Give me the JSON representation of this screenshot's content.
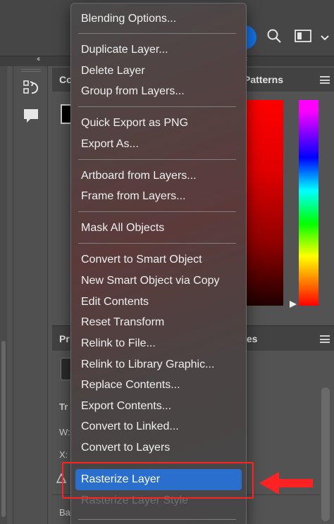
{
  "background": {
    "color_panel_tab_fragment": "Co",
    "patterns_tab_label": "Patterns",
    "properties_tab_fragment": "Pr",
    "libraries_tab_fragment": "ies",
    "transform_label_fragment": "Tr",
    "width_label": "W:",
    "x_label": "X:",
    "background_label_fragment": "Ba"
  },
  "context_menu": {
    "items": [
      {
        "label": "Blending Options..."
      },
      {
        "label": "Duplicate Layer..."
      },
      {
        "label": "Delete Layer"
      },
      {
        "label": "Group from Layers..."
      },
      {
        "label": "Quick Export as PNG"
      },
      {
        "label": "Export As..."
      },
      {
        "label": "Artboard from Layers..."
      },
      {
        "label": "Frame from Layers..."
      },
      {
        "label": "Mask All Objects"
      },
      {
        "label": "Convert to Smart Object"
      },
      {
        "label": "New Smart Object via Copy"
      },
      {
        "label": "Edit Contents"
      },
      {
        "label": "Reset Transform"
      },
      {
        "label": "Relink to File..."
      },
      {
        "label": "Relink to Library Graphic..."
      },
      {
        "label": "Replace Contents..."
      },
      {
        "label": "Export Contents..."
      },
      {
        "label": "Convert to Linked..."
      },
      {
        "label": "Convert to Layers"
      },
      {
        "label": "Rasterize Layer",
        "state": "highlighted"
      },
      {
        "label": "Rasterize Layer Style",
        "state": "disabled"
      }
    ]
  },
  "colors": {
    "highlight": "#2a6fce",
    "annotation_red": "#ff2222",
    "accent_blue": "#1473e6"
  }
}
